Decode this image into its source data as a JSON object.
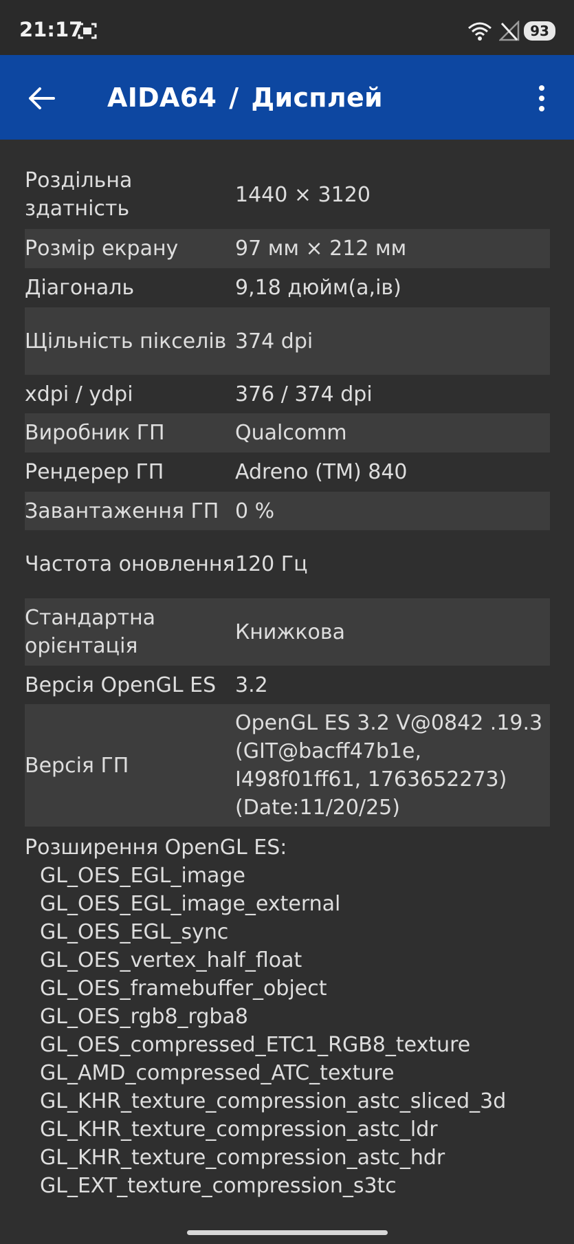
{
  "status_bar": {
    "time": "21:17",
    "battery": "93",
    "icons": [
      "screen-capture-icon",
      "wifi-icon",
      "no-signal-icon"
    ]
  },
  "appbar": {
    "app_name": "AIDA64",
    "separator": "/",
    "page": "Дисплей",
    "color": "#0d47a1"
  },
  "rows": [
    {
      "key": "Роздільна здатність",
      "value": "1440 × 3120"
    },
    {
      "key": "Розмір екрану",
      "value": "97 мм × 212 мм"
    },
    {
      "key": "Діагональ",
      "value": "9,18 дюйм(а,ів)"
    },
    {
      "key": "Щільність пікселів",
      "value": "374 dpi"
    },
    {
      "key": "xdpi / ydpi",
      "value": "376 / 374 dpi"
    },
    {
      "key": "Виробник ГП",
      "value": "Qualcomm"
    },
    {
      "key": "Рендерер ГП",
      "value": "Adreno (TM) 840"
    },
    {
      "key": "Завантаження ГП",
      "value": "0 %"
    },
    {
      "key": "Частота оновлення",
      "value": "120 Гц"
    },
    {
      "key": "Стандартна орієнтація",
      "value": "Книжкова"
    },
    {
      "key": "Версія OpenGL ES",
      "value": "3.2"
    },
    {
      "key": "Версія ГП",
      "value": "OpenGL ES 3.2 V@0842 .19.3 (GIT@bacff47b1e, I498f01ff61, 1763652273) (Date:11/20/25)"
    }
  ],
  "extensions_header": "Розширення OpenGL ES:",
  "extensions": [
    "GL_OES_EGL_image",
    "GL_OES_EGL_image_external",
    "GL_OES_EGL_sync",
    "GL_OES_vertex_half_float",
    "GL_OES_framebuffer_object",
    "GL_OES_rgb8_rgba8",
    "GL_OES_compressed_ETC1_RGB8_texture",
    "GL_AMD_compressed_ATC_texture",
    "GL_KHR_texture_compression_astc_sliced_3d",
    "GL_KHR_texture_compression_astc_ldr",
    "GL_KHR_texture_compression_astc_hdr",
    "GL_EXT_texture_compression_s3tc"
  ]
}
